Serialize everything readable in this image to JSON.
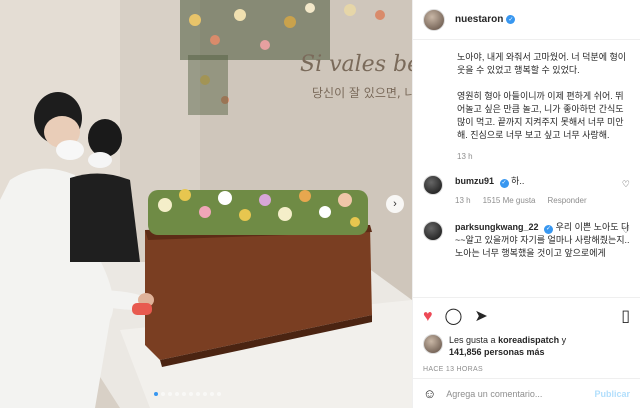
{
  "photo": {
    "wall_text_latin": "Si vales ben",
    "wall_text_korean": "당신이 잘 있으면, 나도"
  },
  "post": {
    "username": "nuestaron",
    "caption": "노아야, 내게 와줘서 고마웠어. 너 덕분에 형이 웃을 수 있었고 행복할 수 있었다.\n\n영원히 형아 아들이니까 이제 편하게 쉬어. 뛰어놀고 싶은 만큼 놀고, 니가 좋아하던 간식도 많이 먹고. 끝까지 지켜주지 못해서 너무 미안해. 진심으로 너무 보고 싶고 너무 사랑해.",
    "caption_time": "13 h"
  },
  "comments": [
    {
      "username": "bumzu91",
      "text": "하..",
      "time": "13 h",
      "likes": "1515 Me gusta",
      "reply": "Responder"
    },
    {
      "username": "parksungkwang_22",
      "text": "우리 이쁜 노아도 다~~알고 있을꺼야 자기를 얼마나 사랑해줬는지..노아는 너무 행복했을 것이고 앞으로에게"
    }
  ],
  "actions": {
    "liked_by_prefix": "Les gusta a",
    "liked_by_user": "koreadispatch",
    "liked_by_suffix": "y",
    "others_count": "141,856 personas más",
    "posted_ago": "HACE 13 HORAS"
  },
  "add_comment": {
    "placeholder": "Agrega un comentario...",
    "post_label": "Publicar"
  },
  "colors": {
    "verified": "#3897f0",
    "like_red": "#ed4956",
    "post_disabled": "#b2dffc"
  },
  "icons": [
    "chevron-right-icon",
    "heart-icon",
    "comment-icon",
    "share-icon",
    "bookmark-icon",
    "emoji-icon",
    "verified-icon"
  ]
}
